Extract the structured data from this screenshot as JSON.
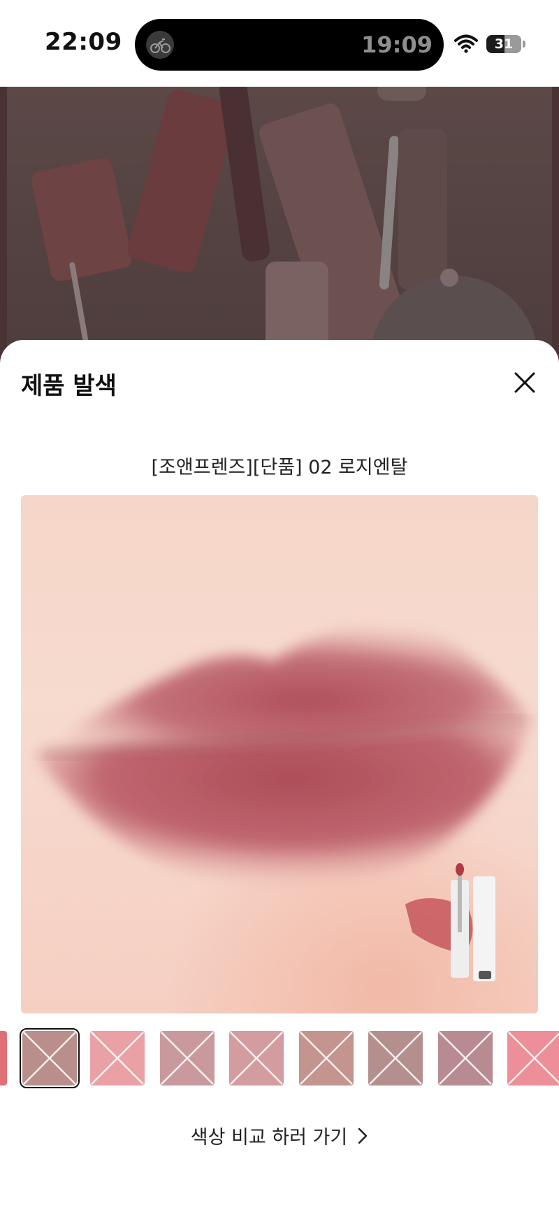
{
  "status_bar": {
    "time": "22:09",
    "island_time": "19:09",
    "battery": "31",
    "island_icon": "cycling-icon"
  },
  "sheet": {
    "title": "제품 발색",
    "close_icon": "close-icon",
    "product_name": "[조앤프렌즈][단품] 02 로지엔탈",
    "compare_label": "색상 비교 하러 가기",
    "compare_icon": "chevron-right-icon"
  },
  "colors": {
    "chip_partial_left": "#e07075",
    "chips": [
      "#b98e8b",
      "#e9a1a6",
      "#c9999e",
      "#d39c9f",
      "#c4948f",
      "#b48f8d",
      "#b88b92",
      "#ec8f98"
    ],
    "selected_chip_index": 0,
    "lip_color": "#b45761"
  }
}
